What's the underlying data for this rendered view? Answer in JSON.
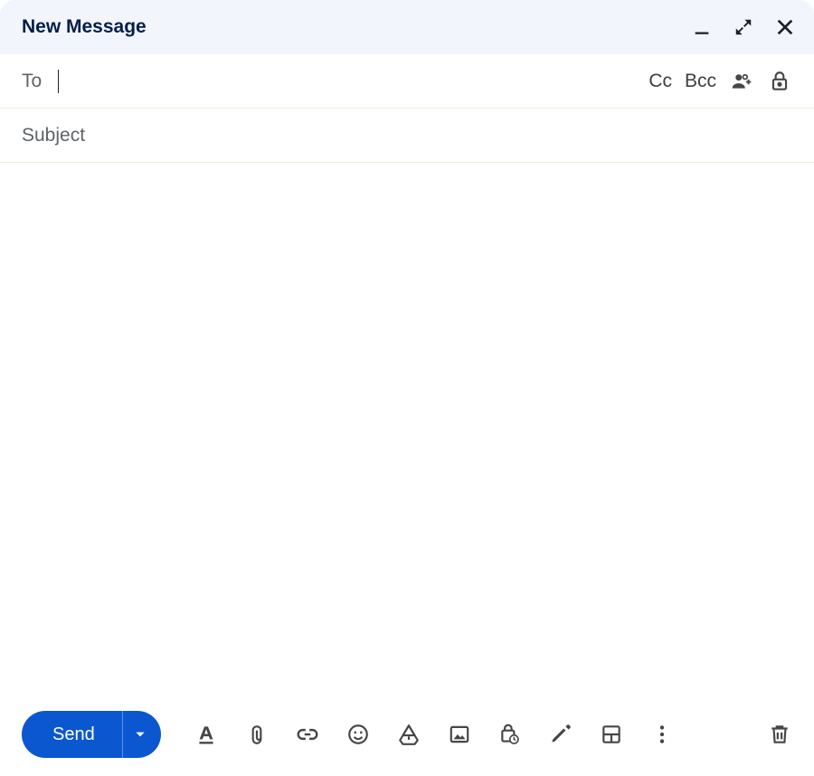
{
  "header": {
    "title": "New Message"
  },
  "to_row": {
    "label": "To",
    "value": "",
    "cc_label": "Cc",
    "bcc_label": "Bcc"
  },
  "subject": {
    "placeholder": "Subject",
    "value": ""
  },
  "body": {
    "value": ""
  },
  "toolbar": {
    "send_label": "Send"
  },
  "icons": {
    "minimize": "minimize-icon",
    "fullscreen": "fullscreen-icon",
    "close": "close-icon",
    "contacts": "contacts-icon",
    "lock": "lock-icon",
    "formatting": "formatting-icon",
    "attach": "attach-icon",
    "link": "link-icon",
    "emoji": "emoji-icon",
    "drive": "drive-icon",
    "image": "image-icon",
    "confidential": "confidential-icon",
    "signature": "signature-icon",
    "layout": "layout-icon",
    "more": "more-icon",
    "delete": "delete-icon"
  },
  "colors": {
    "accent": "#0b57d0",
    "header_bg": "#f2f6fc",
    "text_dark": "#041e49",
    "text_muted": "#5f6368",
    "icon": "#444746"
  }
}
